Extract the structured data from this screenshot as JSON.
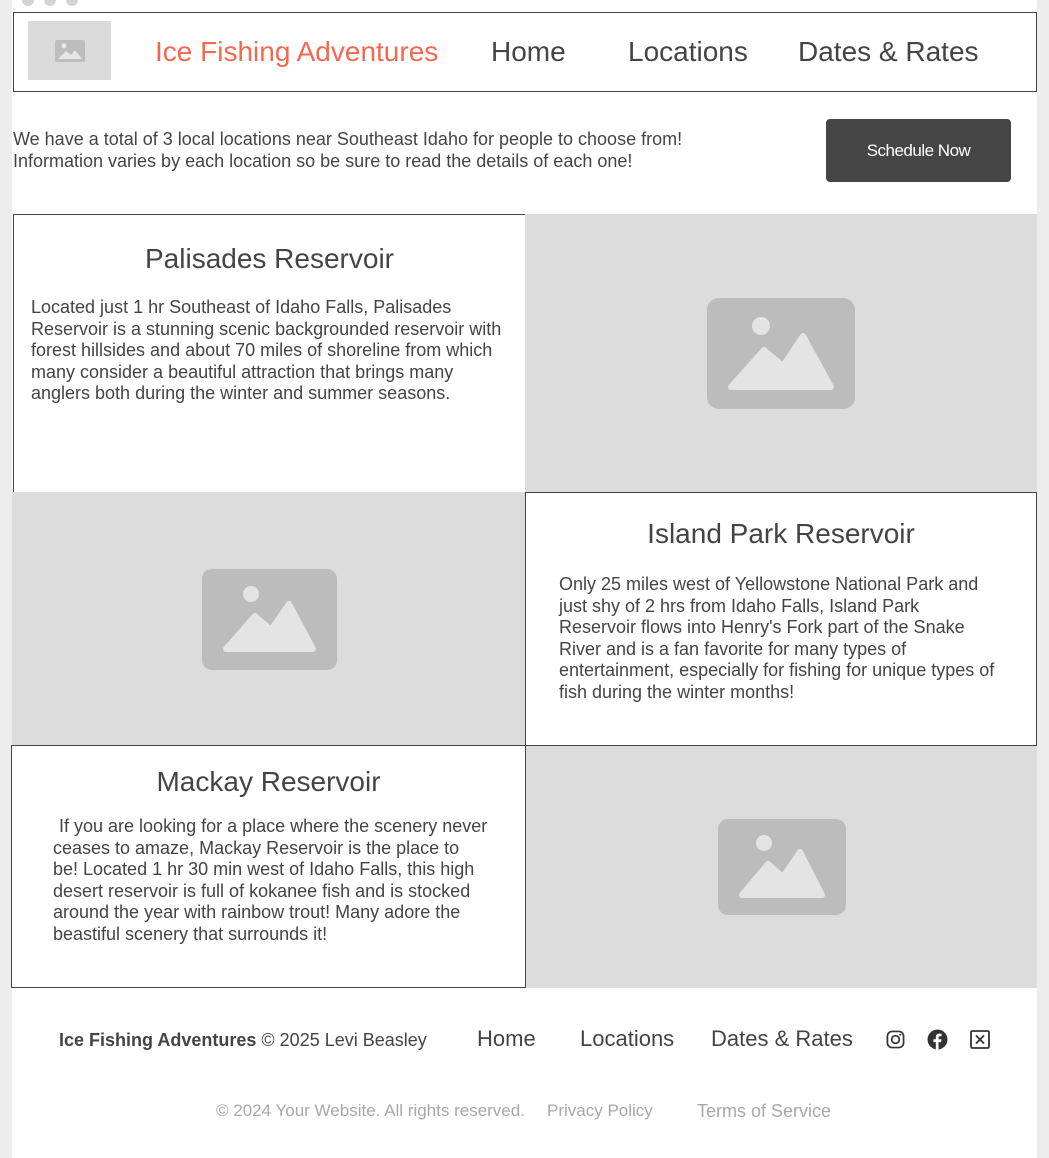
{
  "header": {
    "brand": "Ice Fishing Adventures",
    "nav": [
      "Home",
      "Locations",
      "Dates & Rates"
    ]
  },
  "intro": {
    "line1": "We have a total of 3 local locations near Southeast Idaho for people to choose from!",
    "line2": "Information varies by each location so be sure to read the details of each one!",
    "button": "Schedule Now"
  },
  "locations": [
    {
      "title": "Palisades Reservoir",
      "description": "Located just 1 hr Southeast of Idaho Falls, Palisades Reservoir is a stunning scenic backgrounded reservoir with forest hillsides and about 70 miles of shoreline from which many consider a beautiful attraction that brings many anglers both during the winter and summer seasons."
    },
    {
      "title": "Island Park Reservoir",
      "description": "Only 25 miles west of Yellowstone National Park and just shy of 2 hrs from Idaho Falls, Island Park Reservoir flows into Henry's Fork part of the Snake River and is a fan favorite for many types of entertainment, especially for fishing for unique types of fish during the winter months!"
    },
    {
      "title": "Mackay Reservoir",
      "description": "If you are looking for a place where the scenery never ceases to amaze, Mackay Reservoir is the place to be! Located 1 hr 30 min west of Idaho Falls, this high desert reservoir is full of kokanee fish and is stocked around the year with rainbow trout! Many adore the beastiful scenery that surrounds it!"
    }
  ],
  "footer": {
    "brand": "Ice Fishing Adventures",
    "copyright": "© 2025 Levi Beasley",
    "nav": [
      "Home",
      "Locations",
      "Dates & Rates"
    ],
    "social": [
      "instagram-icon",
      "facebook-icon",
      "x-icon"
    ],
    "legal": {
      "rights": "© 2024 Your Website. All rights reserved.",
      "privacy": "Privacy Policy",
      "terms": "Terms of Service"
    }
  },
  "colors": {
    "accent": "#f4694d",
    "text": "#444444",
    "button": "#454545",
    "placeholder": "#dcdcdc",
    "placeholder_icon": "#bcbcbc"
  }
}
